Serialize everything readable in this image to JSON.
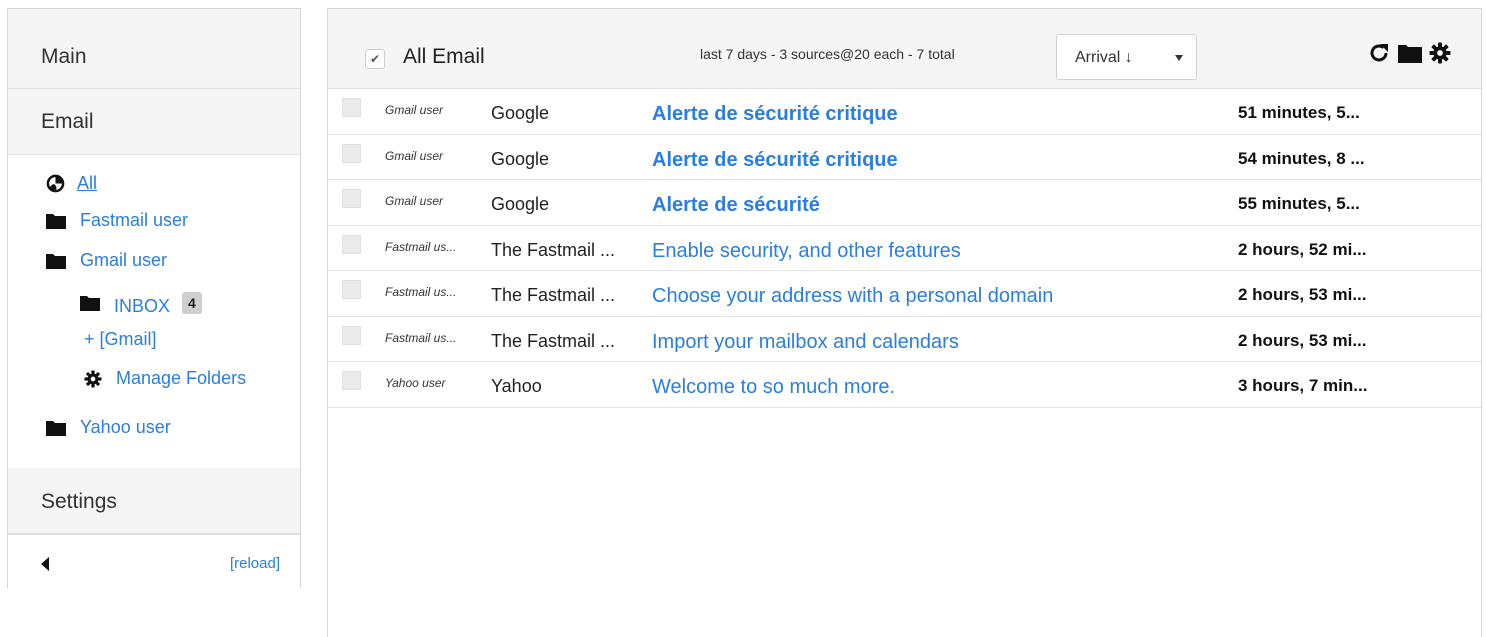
{
  "sidebar": {
    "sections": {
      "main": "Main",
      "email": "Email",
      "settings": "Settings"
    },
    "tree": {
      "all": "All",
      "fastmail": "Fastmail user",
      "gmail": "Gmail user",
      "inbox": "INBOX",
      "inbox_count": "4",
      "gmail_sub": "+ [Gmail]",
      "manage": "Manage Folders",
      "yahoo": "Yahoo user"
    },
    "footer": {
      "reload": "[reload]"
    }
  },
  "toolbar": {
    "title": "All Email",
    "summary": "last 7 days - 3 sources@20 each - 7 total",
    "sort": "Arrival ↓",
    "icons": [
      "refresh-icon",
      "folder-icon",
      "gear-icon"
    ]
  },
  "messages": [
    {
      "account": "Gmail user",
      "sender": "Google",
      "subject": "Alerte de sécurité critique",
      "time": "51 minutes, 5...",
      "unread": true
    },
    {
      "account": "Gmail user",
      "sender": "Google",
      "subject": "Alerte de sécurité critique",
      "time": "54 minutes, 8 ...",
      "unread": true
    },
    {
      "account": "Gmail user",
      "sender": "Google",
      "subject": "Alerte de sécurité",
      "time": "55 minutes, 5...",
      "unread": true
    },
    {
      "account": "Fastmail us...",
      "sender": "The Fastmail ...",
      "subject": "Enable security, and other features",
      "time": "2 hours, 52 mi...",
      "unread": false
    },
    {
      "account": "Fastmail us...",
      "sender": "The Fastmail ...",
      "subject": "Choose your address with a personal domain",
      "time": "2 hours, 53 mi...",
      "unread": false
    },
    {
      "account": "Fastmail us...",
      "sender": "The Fastmail ...",
      "subject": "Import your mailbox and calendars",
      "time": "2 hours, 53 mi...",
      "unread": false
    },
    {
      "account": "Yahoo user",
      "sender": "Yahoo",
      "subject": "Welcome to so much more.",
      "time": "3 hours, 7 min...",
      "unread": false
    }
  ],
  "colors": {
    "link": "#2a7de1",
    "panel_bg": "#f5f5f5",
    "border": "#d6d6d6"
  }
}
